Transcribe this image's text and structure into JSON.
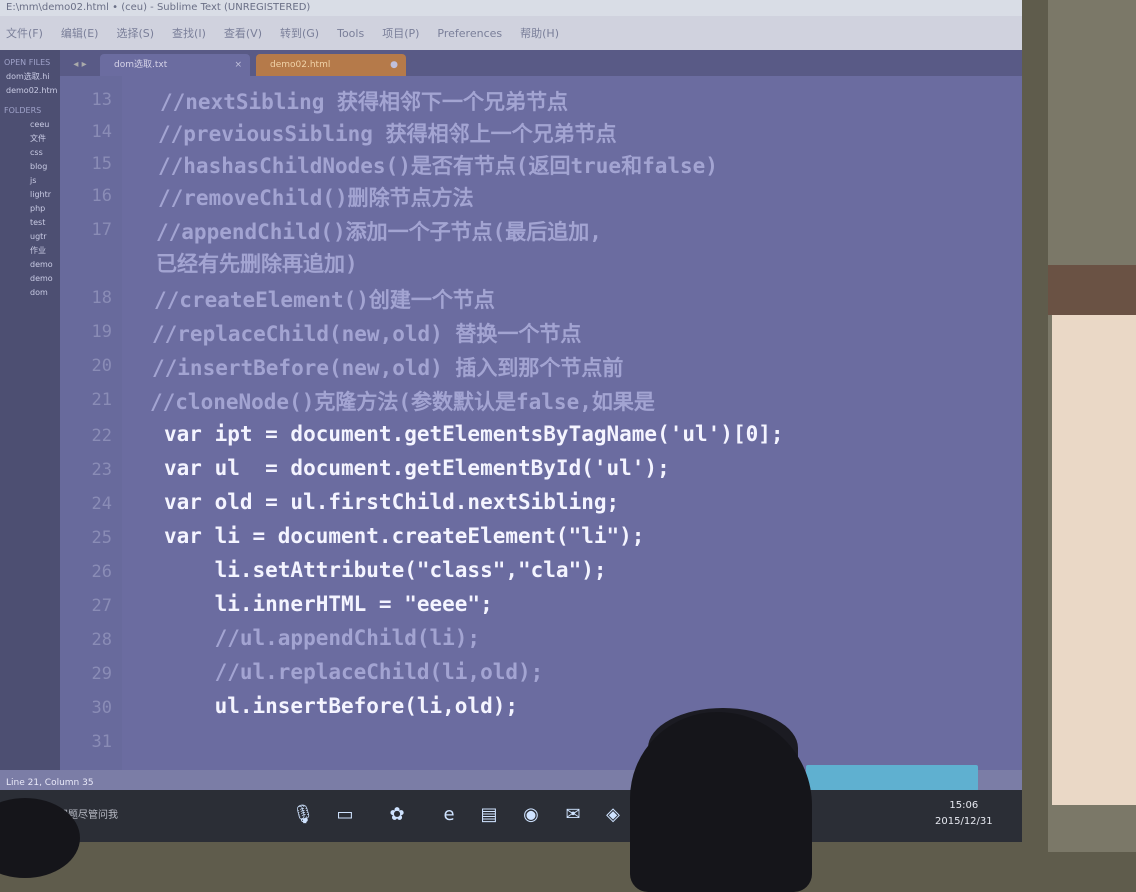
{
  "window": {
    "title": "E:\\mm\\demo02.html • (ceu) - Sublime Text (UNREGISTERED)"
  },
  "menu": [
    "文件(F)",
    "编辑(E)",
    "选择(S)",
    "查找(I)",
    "查看(V)",
    "转到(G)",
    "Tools",
    "项目(P)",
    "Preferences",
    "帮助(H)"
  ],
  "sidebar": {
    "header_open": "OPEN FILES",
    "open_files": [
      "dom选取.hi",
      "demo02.htm"
    ],
    "header_folders": "FOLDERS",
    "folders": [
      "ceeu",
      "文件",
      "css",
      "blog",
      "js",
      "lightr",
      "php",
      "test",
      "ugtr",
      "作业",
      "demo",
      "demo",
      "dom"
    ]
  },
  "tabs": [
    {
      "label": "dom选取.txt",
      "active": true,
      "close": "×"
    },
    {
      "label": "demo02.html",
      "active": false,
      "close": "●"
    }
  ],
  "tab_nav": "◂ ▸",
  "line_numbers": [
    "13",
    "14",
    "15",
    "16",
    "17",
    "",
    "18",
    "19",
    "20",
    "21",
    "22",
    "23",
    "24",
    "25",
    "26",
    "27",
    "28",
    "29",
    "30",
    "31"
  ],
  "code_lines": [
    {
      "type": "comment",
      "text": "//nextSibling 获得相邻下一个兄弟节点"
    },
    {
      "type": "comment",
      "text": "//previousSibling 获得相邻上一个兄弟节点"
    },
    {
      "type": "comment",
      "text": "//hashasChildNodes()是否有节点(返回true和false)"
    },
    {
      "type": "comment",
      "text": "//removeChild()删除节点方法"
    },
    {
      "type": "comment",
      "text": "//appendChild()添加一个子节点(最后追加,"
    },
    {
      "type": "comment",
      "text": "已经有先删除再追加)"
    },
    {
      "type": "comment",
      "text": "//createElement()创建一个节点"
    },
    {
      "type": "comment",
      "text": "//replaceChild(new,old) 替换一个节点"
    },
    {
      "type": "comment",
      "text": "//insertBefore(new,old) 插入到那个节点前"
    },
    {
      "type": "comment",
      "text": "//cloneNode()克隆方法(参数默认是false,如果是"
    },
    {
      "type": "code",
      "text": "var ipt = document.getElementsByTagName('ul')[0];"
    },
    {
      "type": "code",
      "text": "var ul  = document.getElementById('ul');"
    },
    {
      "type": "code",
      "text": "var old = ul.firstChild.nextSibling;"
    },
    {
      "type": "code",
      "text": "var li = document.createElement(\"li\");"
    },
    {
      "type": "code",
      "text": "    li.setAttribute(\"class\",\"cla\");"
    },
    {
      "type": "code",
      "text": "    li.innerHTML = \"eeee\";"
    },
    {
      "type": "comment",
      "text": "    //ul.appendChild(li);"
    },
    {
      "type": "comment",
      "text": "    //ul.replaceChild(li,old);"
    },
    {
      "type": "code",
      "text": "    ul.insertBefore(li,old);"
    },
    {
      "type": "code",
      "text": ""
    }
  ],
  "statusbar": {
    "position": "Line 21, Column 35"
  },
  "taskbar": {
    "search_placeholder": "有问题尽管问我",
    "icons": [
      "mic-icon",
      "task-view-icon",
      "app-icon",
      "edge-icon",
      "explorer-icon",
      "chrome-icon",
      "mail-icon",
      "sublime-icon"
    ],
    "time": "15:06",
    "date": "2015/12/31"
  }
}
